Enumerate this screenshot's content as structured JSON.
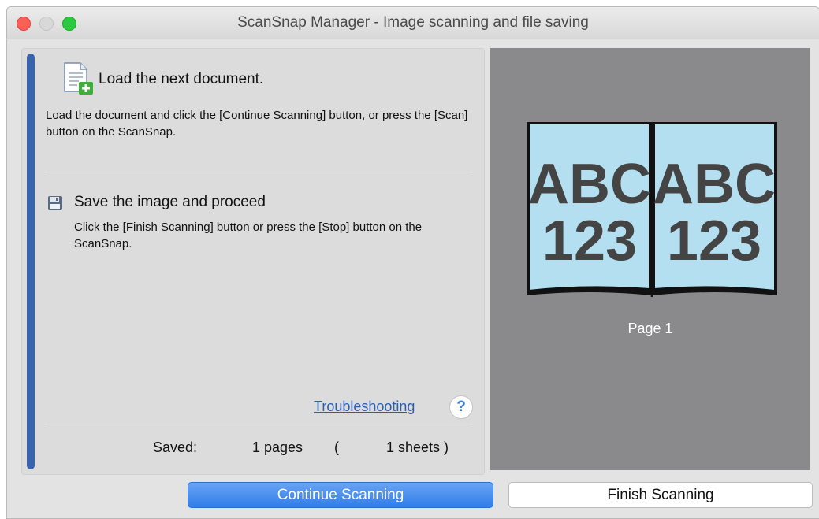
{
  "window": {
    "title": "ScanSnap Manager - Image scanning and file saving"
  },
  "step1": {
    "icon": "document-add-icon",
    "title": "Load the next document.",
    "description": "Load the document and click the [Continue Scanning] button, or press the [Scan] button on the ScanSnap."
  },
  "step2": {
    "icon": "floppy-disk-icon",
    "title": "Save the image and proceed",
    "description": "Click the [Finish Scanning] button or press the [Stop] button on the ScanSnap."
  },
  "troubleshooting": {
    "link_text": "Troubleshooting",
    "help_symbol": "?"
  },
  "saved": {
    "label": "Saved:",
    "pages": "1 pages",
    "open_paren": "(",
    "sheets": "1 sheets )"
  },
  "preview": {
    "left_text_top": "ABC",
    "left_text_bottom": "123",
    "right_text_top": "ABC",
    "right_text_bottom": "123",
    "page_label": "Page 1",
    "page_color": "#b4dff0",
    "background_color": "#8a8a8c"
  },
  "buttons": {
    "continue_label": "Continue Scanning",
    "finish_label": "Finish Scanning"
  },
  "colors": {
    "accent": "#3a63ad",
    "primary_button": "#2f7de9",
    "link": "#2a5db0"
  }
}
